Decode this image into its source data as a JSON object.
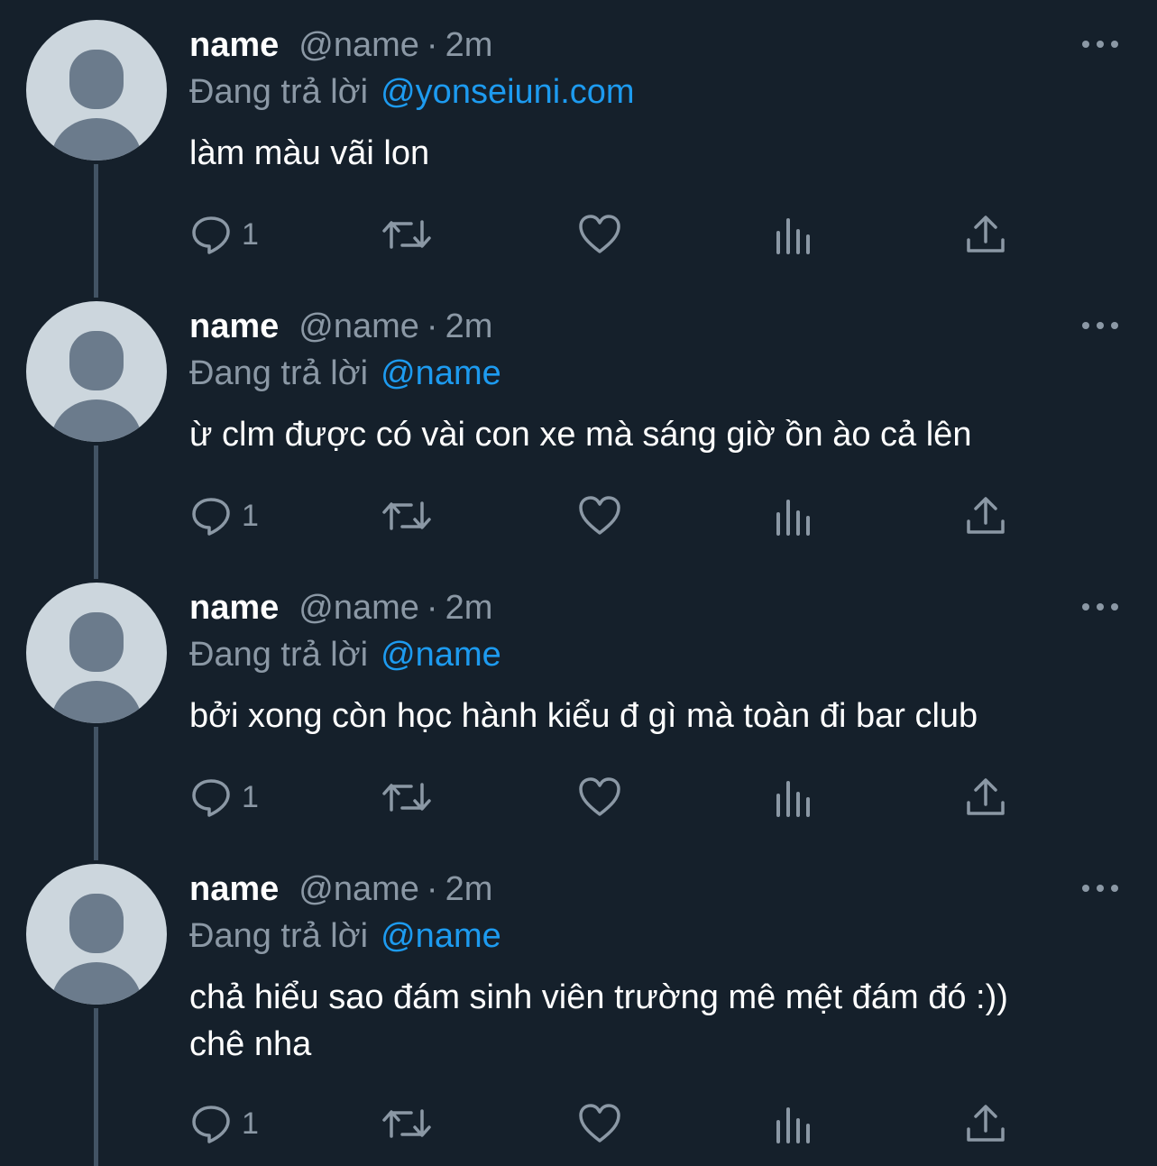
{
  "tweets": [
    {
      "display_name": "name",
      "handle": "@name",
      "separator": "·",
      "time": "2m",
      "reply_label": "Đang trả lời",
      "reply_to": "@yonseiuni.com",
      "text": "làm màu vãi lon",
      "reply_count": "1"
    },
    {
      "display_name": "name",
      "handle": "@name",
      "separator": "·",
      "time": "2m",
      "reply_label": "Đang trả lời",
      "reply_to": "@name",
      "text": "ừ clm được có vài con xe mà sáng giờ ồn ào cả lên",
      "reply_count": "1"
    },
    {
      "display_name": "name",
      "handle": "@name",
      "separator": "·",
      "time": "2m",
      "reply_label": "Đang trả lời",
      "reply_to": "@name",
      "text": "bởi xong còn học hành kiểu đ gì mà toàn đi bar club",
      "reply_count": "1"
    },
    {
      "display_name": "name",
      "handle": "@name",
      "separator": "·",
      "time": "2m",
      "reply_label": "Đang trả lời",
      "reply_to": "@name",
      "text": "chả hiểu sao đám sinh viên trường mê mệt đám đó :)) chê nha",
      "reply_count": "1"
    }
  ],
  "icons": {
    "avatar": "default-avatar-icon",
    "more": "more-horizontal-icon",
    "reply": "reply-bubble-icon",
    "retweet": "retweet-icon",
    "like": "heart-icon",
    "views": "views-chart-icon",
    "share": "share-upload-icon"
  },
  "colors": {
    "background": "#15202b",
    "primary_text": "#ffffff",
    "secondary_text": "#8b98a5",
    "link": "#1d9bf0",
    "thread_line": "#425364",
    "avatar_bg": "#ccd6dd",
    "avatar_fg": "#6b7b8c"
  }
}
